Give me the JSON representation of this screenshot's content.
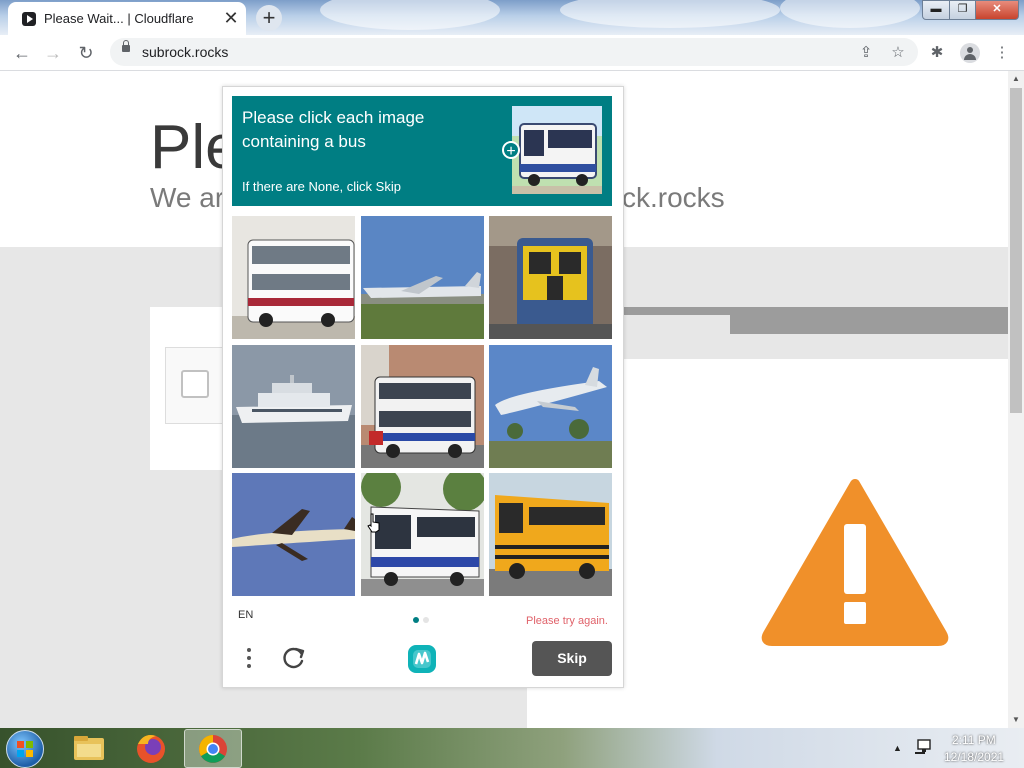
{
  "browser": {
    "tab_title": "Please Wait... | Cloudflare",
    "tab_close": "✕",
    "new_tab": "+",
    "url": "subrock.rocks",
    "back": "←",
    "forward": "→",
    "reload": "↻",
    "share": "⇪",
    "bookmark": "☆",
    "extensions": "✱",
    "menu": "⋮",
    "win_min": "▬",
    "win_max": "❐",
    "win_close": "✕"
  },
  "page": {
    "title": "Ple",
    "subtitle_left": "We ar",
    "subtitle_right": "ck.rocks"
  },
  "captcha": {
    "prompt_line1": "Please click each image",
    "prompt_line2": "containing a bus",
    "hint": "If there are None, click Skip",
    "example_plus": "+",
    "language": "EN",
    "error": "Please try again.",
    "skip_label": "Skip",
    "tiles": [
      {
        "id": "bus-double-decker",
        "selected": false
      },
      {
        "id": "airplane-ground",
        "selected": false
      },
      {
        "id": "train",
        "selected": false
      },
      {
        "id": "ship",
        "selected": false
      },
      {
        "id": "bus-double-decker-street",
        "selected": false
      },
      {
        "id": "airplane-takeoff",
        "selected": false
      },
      {
        "id": "airplane-flying",
        "selected": false
      },
      {
        "id": "bus-white",
        "selected": false
      },
      {
        "id": "school-bus",
        "selected": false
      }
    ],
    "accent_color": "#007e83",
    "error_color": "#e0626a"
  },
  "taskbar": {
    "time": "2:11 PM",
    "date": "12/18/2021",
    "tray_arrow": "▲"
  },
  "scrollbar": {
    "up": "▲",
    "down": "▼"
  }
}
